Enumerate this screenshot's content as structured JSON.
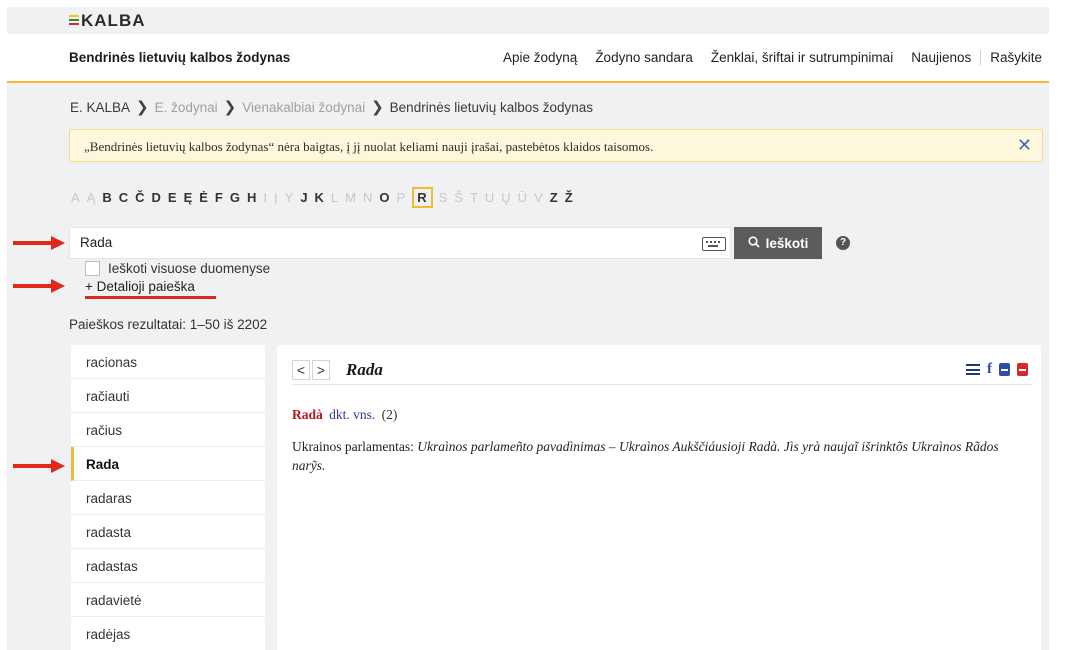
{
  "brand": {
    "name": "KALBA",
    "stripes": [
      "#f5c518",
      "#2e8b3a",
      "#d7262e"
    ]
  },
  "nav": {
    "title": "Bendrinės lietuvių kalbos žodynas",
    "links": [
      "Apie žodyną",
      "Žodyno sandara",
      "Ženklai, šriftai ir sutrumpinimai",
      "Naujienos",
      "Rašykite"
    ]
  },
  "breadcrumb": [
    "E. KALBA",
    "E. žodynai",
    "Vienakalbiai žodynai",
    "Bendrinės lietuvių kalbos žodynas"
  ],
  "notice": {
    "text": "„Bendrinės lietuvių kalbos žodynas“ nėra baigtas, į jį nuolat keliami nauji įrašai, pastebėtos klaidos taisomos."
  },
  "alphabet": [
    {
      "l": "A",
      "s": "off"
    },
    {
      "l": "Ą",
      "s": "off"
    },
    {
      "l": "B",
      "s": "on"
    },
    {
      "l": "C",
      "s": "on"
    },
    {
      "l": "Č",
      "s": "on"
    },
    {
      "l": "D",
      "s": "on"
    },
    {
      "l": "E",
      "s": "on"
    },
    {
      "l": "Ę",
      "s": "on"
    },
    {
      "l": "Ė",
      "s": "on"
    },
    {
      "l": "F",
      "s": "on"
    },
    {
      "l": "G",
      "s": "on"
    },
    {
      "l": "H",
      "s": "on"
    },
    {
      "l": "I",
      "s": "off"
    },
    {
      "l": "Į",
      "s": "off"
    },
    {
      "l": "Y",
      "s": "off"
    },
    {
      "l": "J",
      "s": "on"
    },
    {
      "l": "K",
      "s": "on"
    },
    {
      "l": "L",
      "s": "off"
    },
    {
      "l": "M",
      "s": "off"
    },
    {
      "l": "N",
      "s": "off"
    },
    {
      "l": "O",
      "s": "on"
    },
    {
      "l": "P",
      "s": "off"
    },
    {
      "l": "R",
      "s": "cur"
    },
    {
      "l": "S",
      "s": "off"
    },
    {
      "l": "Š",
      "s": "off"
    },
    {
      "l": "T",
      "s": "off"
    },
    {
      "l": "U",
      "s": "off"
    },
    {
      "l": "Ų",
      "s": "off"
    },
    {
      "l": "Ū",
      "s": "off"
    },
    {
      "l": "V",
      "s": "off"
    },
    {
      "l": "Z",
      "s": "on"
    },
    {
      "l": "Ž",
      "s": "on"
    }
  ],
  "search": {
    "value": "Rada",
    "button_label": "Ieškoti",
    "help": "?",
    "checkbox_label": "Ieškoti visuose duomenyse",
    "checkbox_checked": false,
    "advanced_label": "+ Detalioji paieška",
    "results_text": "Paieškos rezultatai: 1–50 iš 2202"
  },
  "wordlist": {
    "items": [
      "racionas",
      "račiauti",
      "račius",
      "Rada",
      "radaras",
      "radasta",
      "radastas",
      "radavietė",
      "radėjas"
    ],
    "active_index": 3
  },
  "entry": {
    "prev": "<",
    "next": ">",
    "title": "Rada",
    "headword": "Radà",
    "grammar": "dkt. vns.",
    "homonym": "(2)",
    "def_plain": "Ukrainos parlamentas: ",
    "def_example": "Ukraìnos parlameñto pavadìnimas – Ukraìnos Aukščiáusioji Radà. Jìs yrà naujaĩ išrinktõs Ukraìnos Rãdos narỹs."
  },
  "annotation_color": "#e0291c",
  "accent_color": "#f2b932"
}
